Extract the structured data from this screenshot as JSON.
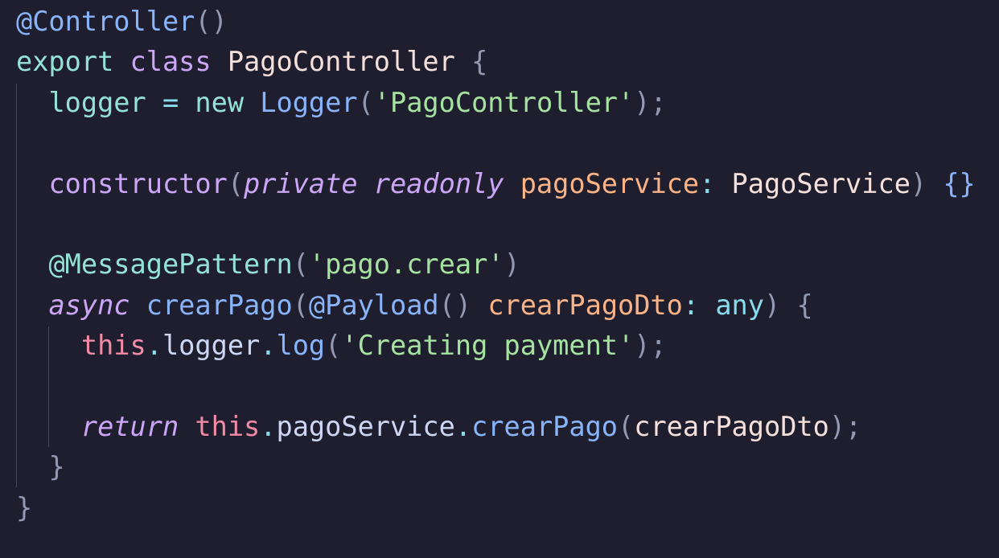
{
  "editor": {
    "language": "typescript",
    "theme_colors": {
      "background": "#1e1e2e",
      "keyword": "#cba6f7",
      "string": "#a6e3a1",
      "function": "#89b4fa",
      "parameter": "#fab387",
      "this": "#f38ba8",
      "property": "#94e2d5",
      "text": "#cdd6f4"
    },
    "lines": [
      {
        "tokens": [
          {
            "text": "@Controller",
            "kind": "decorator"
          },
          {
            "text": "()",
            "kind": "punct"
          }
        ]
      },
      {
        "tokens": [
          {
            "text": "export",
            "kind": "prop"
          },
          {
            "text": " ",
            "kind": "text"
          },
          {
            "text": "class",
            "kind": "keyword"
          },
          {
            "text": " ",
            "kind": "text"
          },
          {
            "text": "PagoController",
            "kind": "class"
          },
          {
            "text": " ",
            "kind": "text"
          },
          {
            "text": "{",
            "kind": "punct"
          }
        ]
      },
      {
        "tokens": [
          {
            "text": "  ",
            "kind": "text"
          },
          {
            "text": "logger",
            "kind": "prop"
          },
          {
            "text": " ",
            "kind": "text"
          },
          {
            "text": "=",
            "kind": "op"
          },
          {
            "text": " ",
            "kind": "text"
          },
          {
            "text": "new",
            "kind": "prop"
          },
          {
            "text": " ",
            "kind": "text"
          },
          {
            "text": "Logger",
            "kind": "type"
          },
          {
            "text": "(",
            "kind": "punct"
          },
          {
            "text": "'PagoController'",
            "kind": "string"
          },
          {
            "text": ");",
            "kind": "punct"
          }
        ]
      },
      {
        "tokens": []
      },
      {
        "tokens": [
          {
            "text": "  ",
            "kind": "text"
          },
          {
            "text": "constructor",
            "kind": "keyword"
          },
          {
            "text": "(",
            "kind": "punct"
          },
          {
            "text": "private",
            "kind": "italic"
          },
          {
            "text": " ",
            "kind": "text"
          },
          {
            "text": "readonly",
            "kind": "italic"
          },
          {
            "text": " ",
            "kind": "text"
          },
          {
            "text": "pagoService",
            "kind": "param"
          },
          {
            "text": ":",
            "kind": "op"
          },
          {
            "text": " ",
            "kind": "text"
          },
          {
            "text": "PagoService",
            "kind": "class"
          },
          {
            "text": ")",
            "kind": "punct"
          },
          {
            "text": " ",
            "kind": "text"
          },
          {
            "text": "{}",
            "kind": "brace"
          }
        ]
      },
      {
        "tokens": []
      },
      {
        "tokens": [
          {
            "text": "  ",
            "kind": "text"
          },
          {
            "text": "@MessagePattern",
            "kind": "prop"
          },
          {
            "text": "(",
            "kind": "punct"
          },
          {
            "text": "'pago.crear'",
            "kind": "string"
          },
          {
            "text": ")",
            "kind": "punct"
          }
        ]
      },
      {
        "tokens": [
          {
            "text": "  ",
            "kind": "text"
          },
          {
            "text": "async",
            "kind": "italic"
          },
          {
            "text": " ",
            "kind": "text"
          },
          {
            "text": "crearPago",
            "kind": "fn"
          },
          {
            "text": "(",
            "kind": "punct"
          },
          {
            "text": "@Payload",
            "kind": "fn"
          },
          {
            "text": "()",
            "kind": "punct"
          },
          {
            "text": " ",
            "kind": "text"
          },
          {
            "text": "crearPagoDto",
            "kind": "param"
          },
          {
            "text": ":",
            "kind": "op"
          },
          {
            "text": " ",
            "kind": "text"
          },
          {
            "text": "any",
            "kind": "any"
          },
          {
            "text": ")",
            "kind": "punct"
          },
          {
            "text": " ",
            "kind": "text"
          },
          {
            "text": "{",
            "kind": "punct"
          }
        ]
      },
      {
        "tokens": [
          {
            "text": "    ",
            "kind": "text"
          },
          {
            "text": "this",
            "kind": "this"
          },
          {
            "text": ".",
            "kind": "op"
          },
          {
            "text": "logger",
            "kind": "text"
          },
          {
            "text": ".",
            "kind": "op"
          },
          {
            "text": "log",
            "kind": "fn"
          },
          {
            "text": "(",
            "kind": "punct"
          },
          {
            "text": "'Creating payment'",
            "kind": "string"
          },
          {
            "text": ");",
            "kind": "punct"
          }
        ]
      },
      {
        "tokens": []
      },
      {
        "tokens": [
          {
            "text": "    ",
            "kind": "text"
          },
          {
            "text": "return",
            "kind": "italic"
          },
          {
            "text": " ",
            "kind": "text"
          },
          {
            "text": "this",
            "kind": "this"
          },
          {
            "text": ".",
            "kind": "op"
          },
          {
            "text": "pagoService",
            "kind": "text"
          },
          {
            "text": ".",
            "kind": "op"
          },
          {
            "text": "crearPago",
            "kind": "fn"
          },
          {
            "text": "(",
            "kind": "punct"
          },
          {
            "text": "crearPagoDto",
            "kind": "class"
          },
          {
            "text": ");",
            "kind": "punct"
          }
        ]
      },
      {
        "tokens": [
          {
            "text": "  ",
            "kind": "text"
          },
          {
            "text": "}",
            "kind": "punct"
          }
        ]
      },
      {
        "tokens": [
          {
            "text": "}",
            "kind": "punct"
          }
        ]
      }
    ]
  }
}
